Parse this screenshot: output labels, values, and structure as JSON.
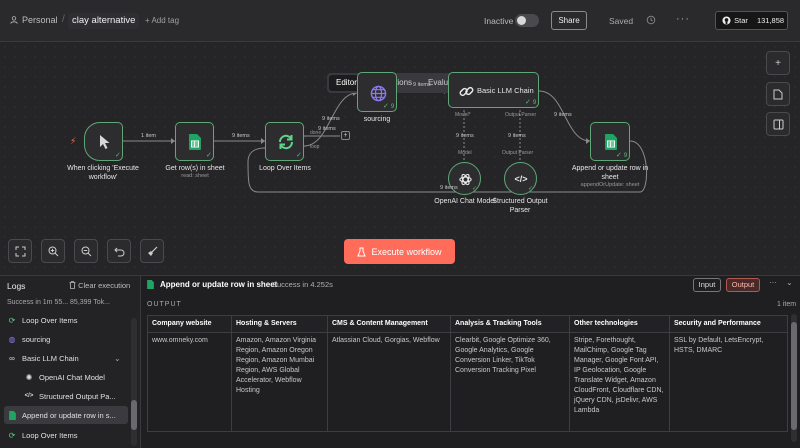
{
  "header": {
    "project": "Personal",
    "workflow_name": "clay alternative",
    "add_tag": "+ Add tag",
    "status": "Inactive",
    "share": "Share",
    "saved": "Saved",
    "more": "···",
    "github_star": "Star",
    "github_count": "131,858"
  },
  "canvas": {
    "tabs": [
      {
        "label": "Editor",
        "active": true
      },
      {
        "label": "Executions",
        "active": false
      },
      {
        "label": "Evaluations",
        "active": false
      }
    ],
    "nodes": {
      "trigger": {
        "label": "When clicking 'Execute workflow'"
      },
      "get_rows": {
        "label": "Get row(s) in sheet",
        "sub": "read: sheet"
      },
      "loop": {
        "label": "Loop Over Items",
        "done": "done",
        "loop": "loop"
      },
      "sourcing": {
        "label": "sourcing",
        "badge": "9"
      },
      "llm_chain": {
        "label": "Basic LLM Chain",
        "badge": "9"
      },
      "append": {
        "label": "Append or update row in sheet",
        "sub": "appendOrUpdate: sheet",
        "badge": "9"
      },
      "openai": {
        "label": "OpenAI Chat Model",
        "badge": "9"
      },
      "parser": {
        "label": "Structured Output Parser",
        "badge": "9"
      }
    },
    "connections": {
      "trigger_to_rows": "1 item",
      "rows_to_loop": "9 items",
      "loop_to_sourcing": "9 items",
      "loop_out": "9 items",
      "sourcing_to_llm": "9 items",
      "llm_to_append": "9 items",
      "llm_model": "9 items",
      "llm_parser": "9 items",
      "append_to_loop": "9 items"
    },
    "sub_ports": {
      "model_top": "Model*",
      "parser_top": "Output Parser",
      "model_bottom": "Model",
      "parser_bottom": "Output Parser"
    },
    "execute_button": "Execute workflow"
  },
  "logs": {
    "title": "Logs",
    "clear": "Clear execution",
    "summary": "Success in 1m 55...   85,399 Tok...",
    "items": [
      {
        "label": "Loop Over Items",
        "icon": "loop-icon"
      },
      {
        "label": "sourcing",
        "icon": "globe-icon"
      },
      {
        "label": "Basic LLM Chain",
        "icon": "chain-icon"
      },
      {
        "label": "OpenAI Chat Model",
        "icon": "openai-icon"
      },
      {
        "label": "Structured Output Pa...",
        "icon": "code-icon"
      },
      {
        "label": "Append or update row in s...",
        "icon": "sheet-icon"
      },
      {
        "label": "Loop Over Items",
        "icon": "loop-icon"
      }
    ]
  },
  "detail": {
    "title": "Append or update row in sheet",
    "status": "Success in 4.252s",
    "input_btn": "Input",
    "output_btn": "Output",
    "output_label": "OUTPUT",
    "item_count": "1 item",
    "table": {
      "headers": [
        "Company website",
        "Hosting & Servers",
        "CMS & Content Management",
        "Analysis & Tracking Tools",
        "Other technologies",
        "Security and Performance"
      ],
      "row": [
        "www.omneky.com",
        "Amazon, Amazon Virginia Region, Amazon Oregon Region, Amazon Mumbai Region, AWS Global Accelerator, Webflow Hosting",
        "Atlassian Cloud, Gorgias, Webflow",
        "Clearbit, Google Optimize 360, Google Analytics, Google Conversion Linker, TikTok Conversion Tracking Pixel",
        "Stripe, Forethought, MailChimp, Google Tag Manager, Google Font API, IP Geolocation, Google Translate Widget, Amazon CloudFront, Cloudflare CDN, jQuery CDN, jsDelivr, AWS Lambda",
        "SSL by Default, LetsEncrypt, HSTS, DMARC"
      ]
    }
  },
  "colors": {
    "accent": "#ff6d5a",
    "success": "#5fa777",
    "sheet_green": "#1fa463"
  }
}
